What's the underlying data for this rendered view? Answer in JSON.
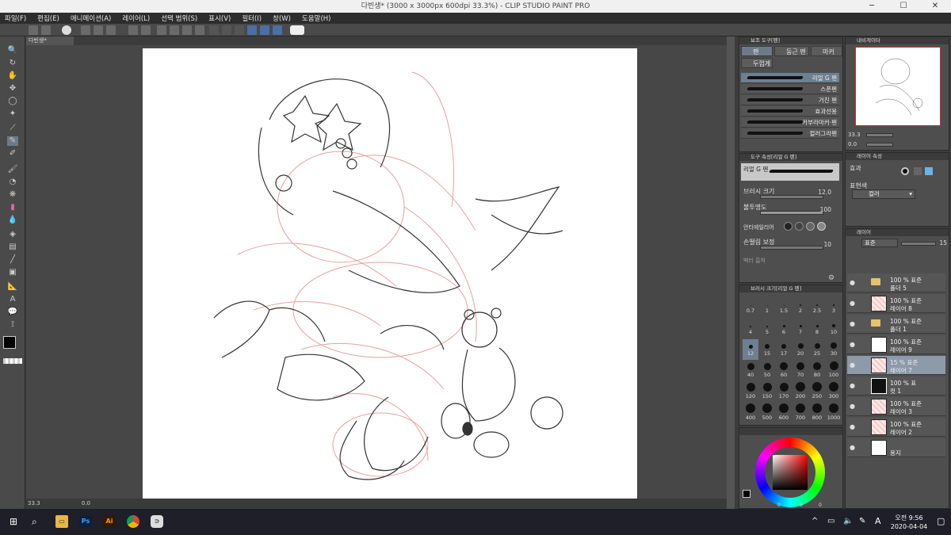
{
  "window": {
    "title": "다빈생* (3000 x 3000px 600dpi 33.3%)  - CLIP STUDIO PAINT PRO"
  },
  "menu": [
    "파일(F)",
    "편집(E)",
    "애니메이션(A)",
    "레이어(L)",
    "선택 범위(S)",
    "표시(V)",
    "필터(I)",
    "창(W)",
    "도움말(H)"
  ],
  "doc_tab": "다빈생*",
  "status": {
    "zoom": "33.3",
    "angle": "0.0"
  },
  "sub_tool": {
    "header": "보조 도구[펜]",
    "tabs": [
      "펜",
      "둥근 펜",
      "마커",
      "두껍게"
    ],
    "brushes": [
      "리얼 G 펜",
      "스푼펜",
      "거친 펜",
      "효과선용",
      "카부라마커·펜",
      "컬러그라펜"
    ]
  },
  "tool_property": {
    "header": "도구 속성[리얼 G 펜]",
    "brush_name": "리얼 G 펜",
    "brush_size_label": "브러시 크기",
    "brush_size": "12.0",
    "opacity_label": "불투명도",
    "opacity": "100",
    "antialias_label": "안티에일리어",
    "stabilization_label": "손떨림 보정",
    "stabilization": "10",
    "vector_label": "벡터 흡착"
  },
  "brush_size_panel": {
    "header": "브러시 크기[리얼 G 펜]",
    "sizes": [
      "0.7",
      "1",
      "1.5",
      "2",
      "2.5",
      "3",
      "4",
      "5",
      "6",
      "7",
      "8",
      "10",
      "12",
      "15",
      "17",
      "20",
      "25",
      "30",
      "40",
      "50",
      "60",
      "70",
      "80",
      "100",
      "120",
      "150",
      "170",
      "200",
      "250",
      "300",
      "400",
      "500",
      "600",
      "700",
      "800",
      "1000"
    ]
  },
  "navigator": {
    "header": "내비게이터",
    "zoom": "33.3",
    "angle": "0.0"
  },
  "layer_property": {
    "header": "레이어 속성",
    "effect_label": "효과",
    "expression_label": "표현색",
    "expression_value": "컬러"
  },
  "layers_panel": {
    "header": "레이어",
    "blend_mode": "표준",
    "opacity": "15",
    "layers": [
      {
        "line1": "100 % 표준",
        "line2": "폴더 5",
        "type": "folder"
      },
      {
        "line1": "100 % 표준",
        "line2": "레이어 8",
        "type": "red"
      },
      {
        "line1": "100 % 표준",
        "line2": "폴더 1",
        "type": "folder"
      },
      {
        "line1": "100 % 표준",
        "line2": "레이어 9",
        "type": "plain"
      },
      {
        "line1": "15 % 표준",
        "line2": "레이어 7",
        "type": "red",
        "selected": true
      },
      {
        "line1": "100 % 표",
        "line2": "컷 1",
        "type": "frame"
      },
      {
        "line1": "100 % 표준",
        "line2": "레이어 3",
        "type": "red"
      },
      {
        "line1": "100 % 표준",
        "line2": "레이어 2",
        "type": "red"
      },
      {
        "line1": "",
        "line2": "용지",
        "type": "paper"
      }
    ]
  },
  "color_panel": {
    "h": "0",
    "s": "0",
    "v": "0"
  },
  "taskbar": {
    "time": "오전 9:56",
    "date": "2020-04-04",
    "ime": "A"
  }
}
